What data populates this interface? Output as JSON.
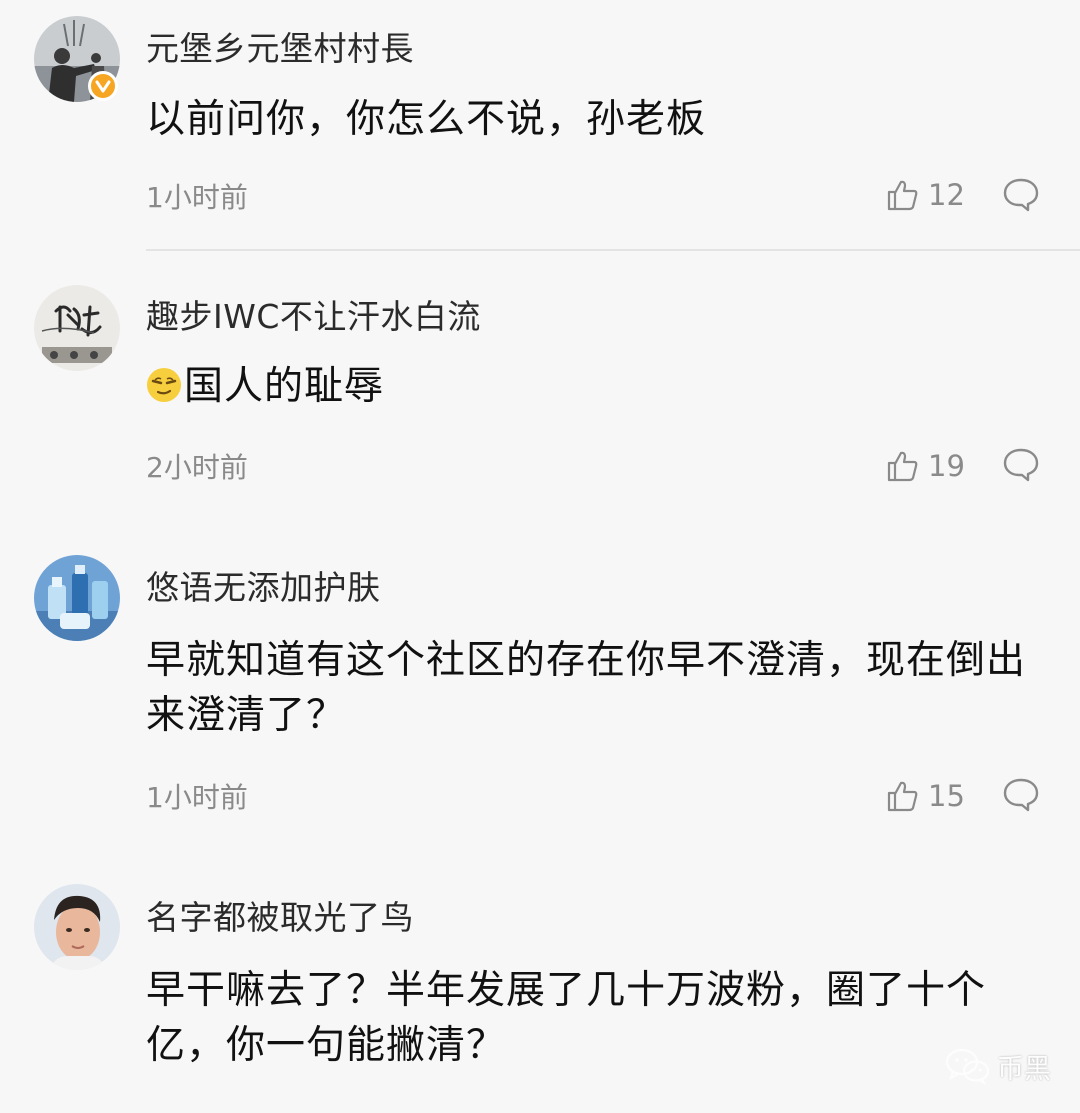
{
  "comments": [
    {
      "username": "元堡乡元堡村村長",
      "content": "以前问你，你怎么不说，孙老板",
      "time": "1小时前",
      "likes": "12",
      "verified": true,
      "avatar_icon": "person-silhouette-avatar"
    },
    {
      "username": "趣步IWC不让汗水白流",
      "content": "国人的耻辱",
      "time": "2小时前",
      "likes": "19",
      "verified": false,
      "avatar_icon": "calligraphy-avatar",
      "emoji": "smug-face-emoji"
    },
    {
      "username": "悠语无添加护肤",
      "content": "早就知道有这个社区的存在你早不澄清，现在倒出来澄清了？",
      "time": "1小时前",
      "likes": "15",
      "verified": false,
      "avatar_icon": "skincare-bottles-avatar"
    },
    {
      "username": "名字都被取光了鸟",
      "content": "早干嘛去了？半年发展了几十万波粉，圈了十个亿，你一句能撇清？",
      "time": "",
      "likes": "",
      "verified": false,
      "avatar_icon": "face-photo-avatar"
    }
  ],
  "watermark": {
    "text": "币黑",
    "icon": "wechat-icon"
  },
  "colors": {
    "background": "#f7f7f7",
    "verified_badge": "#f6a623",
    "secondary_text": "#8a8a8a",
    "divider": "#e4e4e4"
  }
}
